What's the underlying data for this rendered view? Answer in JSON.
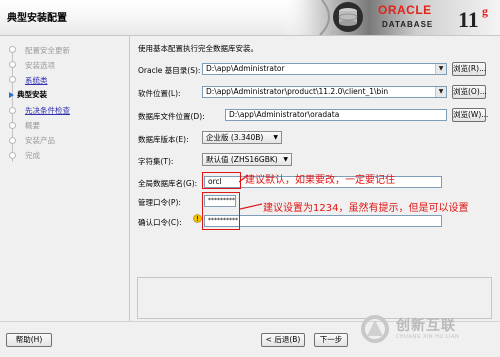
{
  "window": {
    "title": "典型安装配置"
  },
  "banner": {
    "brand": "ORACLE",
    "product": "DATABASE",
    "version": "11",
    "version_sup": "g"
  },
  "sidebar": {
    "items": [
      {
        "label": "配置安全更新",
        "state": "done"
      },
      {
        "label": "安装选项",
        "state": "done"
      },
      {
        "label": "系统类",
        "state": "link"
      },
      {
        "label": "典型安装",
        "state": "current"
      },
      {
        "label": "先决条件检查",
        "state": "link"
      },
      {
        "label": "概要",
        "state": "pending"
      },
      {
        "label": "安装产品",
        "state": "pending"
      },
      {
        "label": "完成",
        "state": "pending"
      }
    ]
  },
  "main": {
    "intro": "使用基本配置执行完全数据库安装。",
    "oracle_base": {
      "label": "Oracle 基目录(S):",
      "value": "D:\\app\\Administrator",
      "browse": "浏览(R)..."
    },
    "software_location": {
      "label": "软件位置(L):",
      "value": "D:\\app\\Administrator\\product\\11.2.0\\client_1\\bin",
      "browse": "浏览(O)..."
    },
    "db_file_location": {
      "label": "数据库文件位置(D):",
      "value": "D:\\app\\Administrator\\oradata",
      "browse": "浏览(W)..."
    },
    "db_edition": {
      "label": "数据库版本(E):",
      "value": "企业版 (3.340B)"
    },
    "charset": {
      "label": "字符集(T):",
      "value": "默认值 (ZHS16GBK)"
    },
    "global_db_name": {
      "label": "全局数据库名(G):",
      "value": "orcl"
    },
    "admin_password": {
      "label": "管理口令(P):",
      "value": "**********"
    },
    "confirm_password": {
      "label": "确认口令(C):",
      "value": "**********"
    }
  },
  "annotations": {
    "db_name_note": "建议默认，如果要改，一定要记住",
    "password_note": "建议设置为1234，虽然有提示，但是可以设置"
  },
  "footer": {
    "help": "帮助(H)",
    "back": "< 后退(B)",
    "next": "下一步"
  },
  "watermark": {
    "name": "创新互联",
    "sub": "CHUANG XIN HU LIAN"
  },
  "colors": {
    "annotation_red": "#e01515",
    "field_border": "#7f9db9",
    "oracle_red": "#e2231a",
    "link_blue": "#2f2fb0"
  }
}
